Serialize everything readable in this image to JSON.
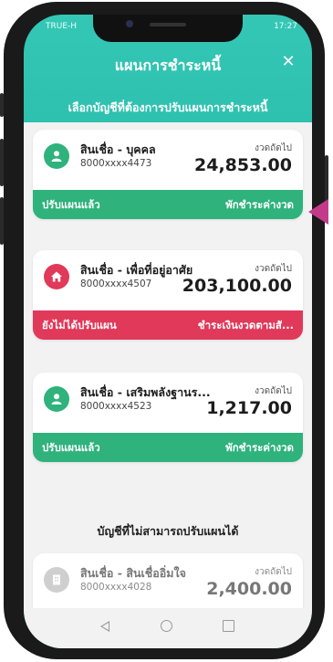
{
  "status_bar": {
    "carrier": "TRUE-H",
    "time": "17:27"
  },
  "header": {
    "title": "แผนการชำระหนี้",
    "close_icon": "close-icon"
  },
  "subtitle": "เลือกบัญชีที่ต้องการปรับแผนการชำระหนี้",
  "colors": {
    "teal": "#2bbcaa",
    "green": "#2fb27c",
    "red": "#e0395a",
    "pointer": "#c43a8a"
  },
  "cards": [
    {
      "icon": "person-icon",
      "name": "สินเชื่อ - บุคคล",
      "account": "8000xxxx4473",
      "next_label": "งวดถัดไป",
      "amount": "24,853.00",
      "status_left": "ปรับแผนแล้ว",
      "status_right": "พักชำระค่างวด"
    },
    {
      "icon": "home-icon",
      "name": "สินเชื่อ - เพื่อที่อยู่อาศัย",
      "account": "8000xxxx4507",
      "next_label": "งวดถัดไป",
      "amount": "203,100.00",
      "status_left": "ยังไม่ได้ปรับแผน",
      "status_right": "ชำระเงินงวดตามสั..."
    },
    {
      "icon": "person-icon",
      "name": "สินเชื่อ - เสริมพลังฐานร...",
      "account": "8000xxxx4523",
      "next_label": "งวดถัดไป",
      "amount": "1,217.00",
      "status_left": "ปรับแผนแล้ว",
      "status_right": "พักชำระค่างวด"
    }
  ],
  "section_title": "บัญชีที่ไม่สามารถปรับแผนได้",
  "disabled_card": {
    "icon": "building-icon",
    "name": "สินเชื่อ - สินเชื่ออิ่มใจ",
    "account": "8000xxxx4028",
    "next_label": "งวดถัดไป",
    "amount": "2,400.00"
  }
}
